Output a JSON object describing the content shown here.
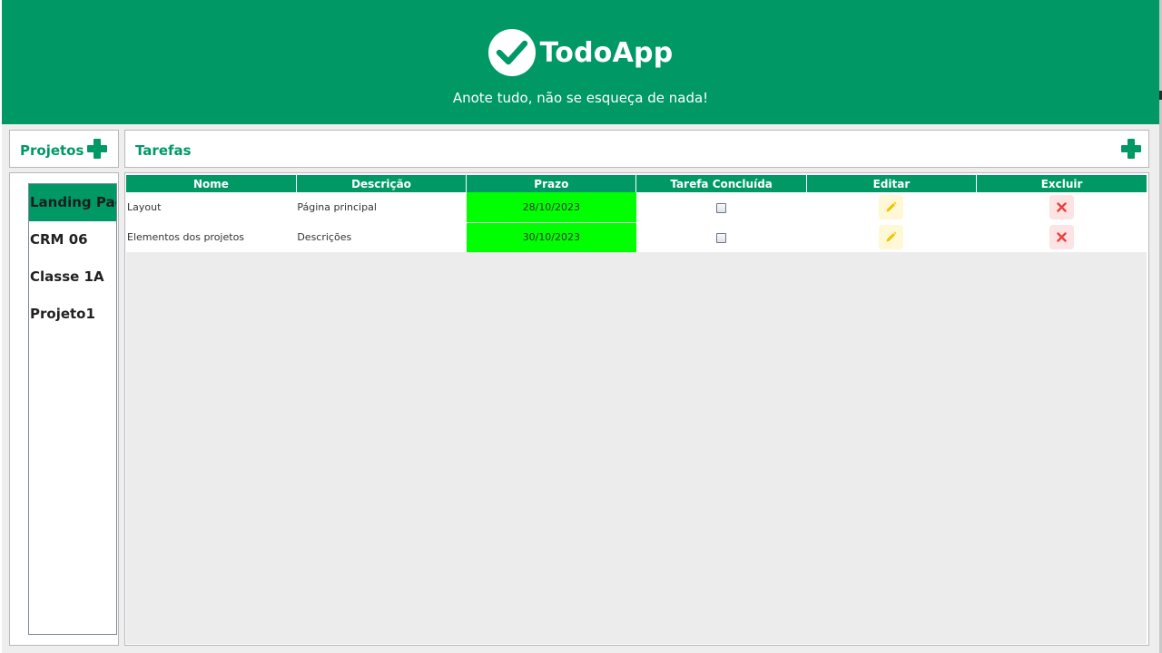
{
  "app": {
    "title": "TodoApp",
    "subtitle": "Anote tudo, não se esqueça de nada!"
  },
  "projects": {
    "title": "Projetos",
    "items": [
      {
        "label": "Landing Page",
        "selected": true
      },
      {
        "label": "CRM 06",
        "selected": false
      },
      {
        "label": "Classe 1A",
        "selected": false
      },
      {
        "label": "Projeto1",
        "selected": false
      }
    ]
  },
  "tasks": {
    "title": "Tarefas",
    "columns": [
      "Nome",
      "Descrição",
      "Prazo",
      "Tarefa Concluída",
      "Editar",
      "Excluir"
    ],
    "rows": [
      {
        "name": "Layout",
        "description": "Página principal",
        "deadline": "28/10/2023",
        "done": false
      },
      {
        "name": "Elementos dos projetos",
        "description": "Descrições",
        "deadline": "30/10/2023",
        "done": false
      }
    ]
  },
  "colors": {
    "brand": "#009966",
    "deadline_highlight": "#00ff00",
    "edit_icon": "#f2c200",
    "delete_icon": "#e8423f"
  },
  "icons": {
    "logo": "check-circle-icon",
    "add": "plus-icon",
    "edit": "pencil-icon",
    "delete": "x-icon"
  }
}
